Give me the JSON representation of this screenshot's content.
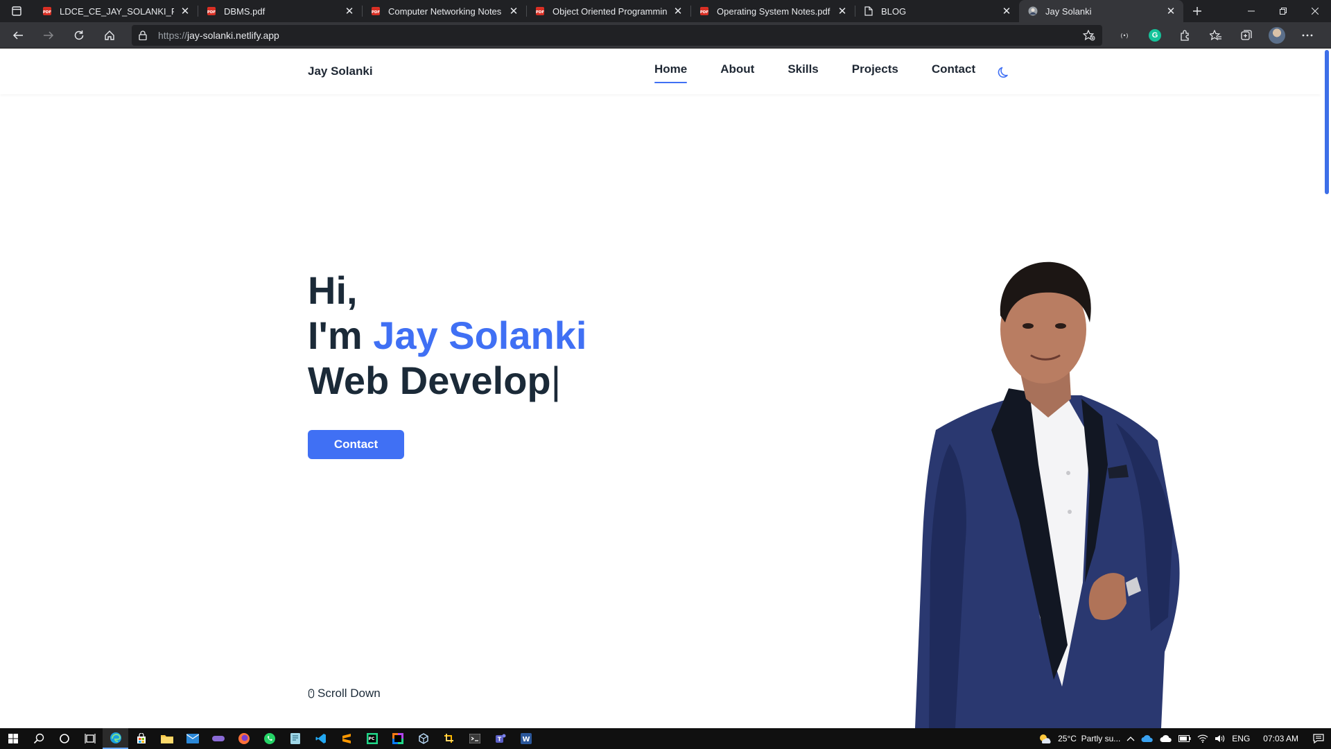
{
  "browser": {
    "tabs": [
      {
        "title": "LDCE_CE_JAY_SOLANKI_RESUME",
        "icon": "pdf-icon",
        "active": false
      },
      {
        "title": "DBMS.pdf",
        "icon": "pdf-icon",
        "active": false
      },
      {
        "title": "Computer Networking Notes for",
        "icon": "pdf-icon",
        "active": false
      },
      {
        "title": "Object Oriented Programming (",
        "icon": "pdf-icon",
        "active": false
      },
      {
        "title": "Operating System Notes.pdf",
        "icon": "pdf-icon",
        "active": false
      },
      {
        "title": "BLOG",
        "icon": "page-icon",
        "active": false
      },
      {
        "title": "Jay Solanki",
        "icon": "site-avatar-icon",
        "active": true
      }
    ],
    "address": {
      "protocol": "https://",
      "host": "jay-solanki.netlify.app"
    }
  },
  "site": {
    "logo": "Jay Solanki",
    "nav": [
      {
        "label": "Home",
        "active": true
      },
      {
        "label": "About",
        "active": false
      },
      {
        "label": "Skills",
        "active": false
      },
      {
        "label": "Projects",
        "active": false
      },
      {
        "label": "Contact",
        "active": false
      }
    ],
    "hero": {
      "greeting": "Hi,",
      "intro_prefix": "I'm ",
      "name": "Jay Solanki",
      "role_typed": "Web Develop",
      "caret": "|",
      "contact_button": "Contact",
      "scroll_down": "Scroll Down"
    },
    "colors": {
      "accent": "#4070f4",
      "heading": "#1b2a38"
    }
  },
  "taskbar": {
    "weather": "25°C  Partly su...",
    "language": "ENG",
    "time": "07:03 AM"
  }
}
